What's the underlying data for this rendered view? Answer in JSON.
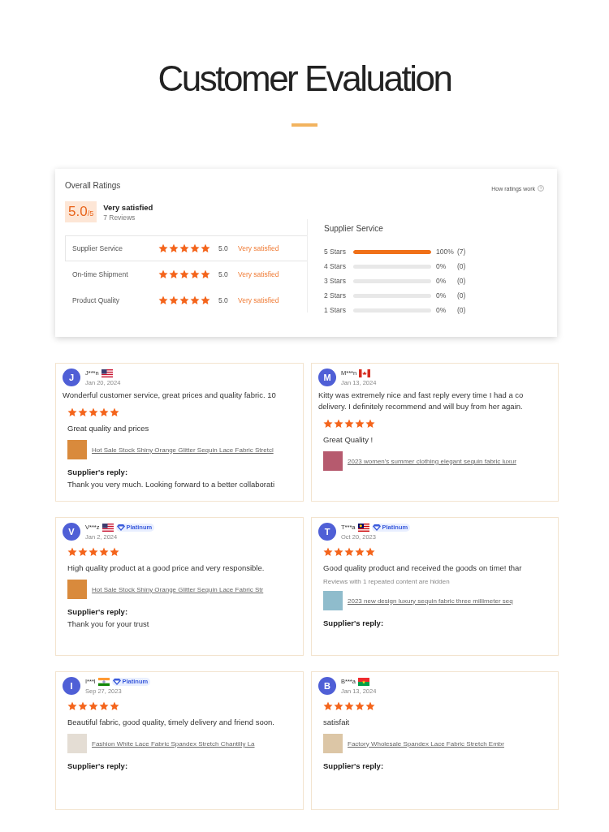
{
  "header": {
    "title": "Customer Evaluation"
  },
  "overall": {
    "title": "Overall Ratings",
    "score": "5.0",
    "out_of": "/5",
    "verdict": "Very satisfied",
    "reviews": "7 Reviews",
    "help_link": "How ratings work",
    "rows": [
      {
        "label": "Supplier Service",
        "stars": 5,
        "score": "5.0",
        "verdict": "Very satisfied",
        "selected": true
      },
      {
        "label": "On-time Shipment",
        "stars": 5,
        "score": "5.0",
        "verdict": "Very satisfied",
        "selected": false
      },
      {
        "label": "Product Quality",
        "stars": 5,
        "score": "5.0",
        "verdict": "Very satisfied",
        "selected": false
      }
    ],
    "breakdown_title": "Supplier Service",
    "bars": [
      {
        "label": "5 Stars",
        "level": 1,
        "percent": "100%",
        "count": "(7)"
      },
      {
        "label": "4 Stars",
        "level": 0,
        "percent": "0%",
        "count": "(0)"
      },
      {
        "label": "3 Stars",
        "level": 0,
        "percent": "0%",
        "count": "(0)"
      },
      {
        "label": "2 Stars",
        "level": 0,
        "percent": "0%",
        "count": "(0)"
      },
      {
        "label": "1 Stars",
        "level": 0,
        "percent": "0%",
        "count": "(0)"
      }
    ]
  },
  "reviews": [
    {
      "initial": "J",
      "name": "J***n",
      "kind": "us",
      "date": "Jan 20, 2024",
      "headline": "Wonderful customer service, great prices and quality fabric. 10",
      "stars": 5,
      "comment": "Great quality and prices",
      "product": "Hot Sale Stock Shiny Orange Glitter Sequin Lace Fabric Stretcl",
      "reply_label": "Supplier's reply:",
      "reply": "Thank you very much. Looking forward to a better collaborati"
    },
    {
      "initial": "M",
      "name": "M***n",
      "kind": "ca",
      "date": "Jan 13, 2024",
      "headline": "Kitty was extremely nice and fast reply every time I had a co delivery. I definitely recommend and will buy from her again.",
      "stars": 5,
      "comment": "Great Quality !",
      "product": "2023 women's summer clothing elegant sequin fabric luxur"
    },
    {
      "initial": "V",
      "name": "V***z",
      "kind": "us",
      "badge": "Platinum",
      "date": "Jan 2, 2024",
      "stars": 5,
      "comment": "High quality product at a good price and very responsible.",
      "product": "Hot Sale Stock Shiny Orange Glitter Sequin Lace Fabric Str",
      "reply_label": "Supplier's reply:",
      "reply": "Thank you for your trust"
    },
    {
      "initial": "T",
      "name": "T***a",
      "kind": "my",
      "badge": "Platinum",
      "date": "Oct 20, 2023",
      "stars": 5,
      "comment": "Good quality product and received the goods on time! thar",
      "note": "Reviews with 1 repeated content are hidden",
      "product": "2023 new design luxury sequin fabric three millimeter seq",
      "reply_label": "Supplier's reply:"
    },
    {
      "initial": "I",
      "name": "I***l",
      "kind": "in",
      "badge": "Platinum",
      "date": "Sep 27, 2023",
      "stars": 5,
      "comment": "Beautiful fabric, good quality, timely delivery and friend soon.",
      "product": "Fashion White Lace Fabric Spandex Stretch Chantilly La",
      "reply_label": "Supplier's reply:"
    },
    {
      "initial": "B",
      "name": "B***a",
      "kind": "bf",
      "date": "Jan 13, 2024",
      "stars": 5,
      "comment": "satisfait",
      "product": "Factory Wholesale Spandex Lace Fabric Stretch Embr",
      "reply_label": "Supplier's reply:"
    }
  ]
}
